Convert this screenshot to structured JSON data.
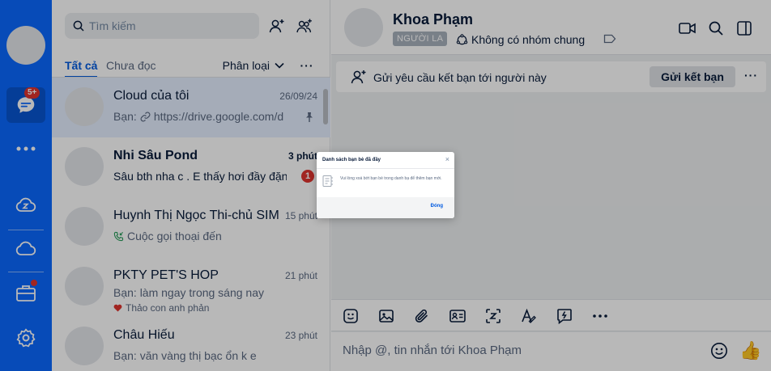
{
  "search": {
    "placeholder": "Tìm kiếm"
  },
  "rail": {
    "chat_badge": "5+"
  },
  "tabs": {
    "all": "Tất cả",
    "unread": "Chưa đọc",
    "filter": "Phân loại",
    "more": "···"
  },
  "conversations": [
    {
      "name": "Cloud của tôi",
      "time": "26/09/24",
      "message": "Bạn: 🔗 https://drive.google.com/d",
      "msg_prefix": "Bạn:",
      "msg_link": "https://drive.google.com/d",
      "pinned": true
    },
    {
      "name": "Nhi Sâu Pond",
      "time": "3 phút",
      "message": "Sâu bth nha c . E thấy hơi đầy đặn đó",
      "unread": "1"
    },
    {
      "name": "Huynh Thị Ngọc Thi-chủ SIM",
      "time": "15 phút",
      "message": "Cuộc gọi thoại đến"
    },
    {
      "name": "PKTY PET'S HOP",
      "time": "21 phút",
      "message": "Bạn: làm ngay trong sáng nay",
      "reaction": "Thảo con anh phản"
    },
    {
      "name": "Châu Hiếu",
      "time": "23 phút",
      "message": "Bạn: văn vàng thị bạc ổn k e"
    }
  ],
  "chat": {
    "name": "Khoa Phạm",
    "stranger_badge": "NGƯỜI LA",
    "groups": "Không có nhóm chung",
    "friend_request_text": "Gửi yêu cầu kết bạn tới người này",
    "send_request_button": "Gửi kết bạn",
    "more": "···",
    "composer_placeholder": "Nhập @, tin nhắn tới Khoa Phạm",
    "like_emoji": "👍"
  },
  "modal": {
    "title": "Danh sách bạn bè đã đầy",
    "body": "Vui lòng xoá bớt bạn bè trong danh bạ để thêm bạn mới.",
    "close": "×",
    "confirm": "Đóng"
  },
  "colors": {
    "rail": "#0a68ff",
    "accent": "#005ae0",
    "badge": "#e0342f"
  }
}
